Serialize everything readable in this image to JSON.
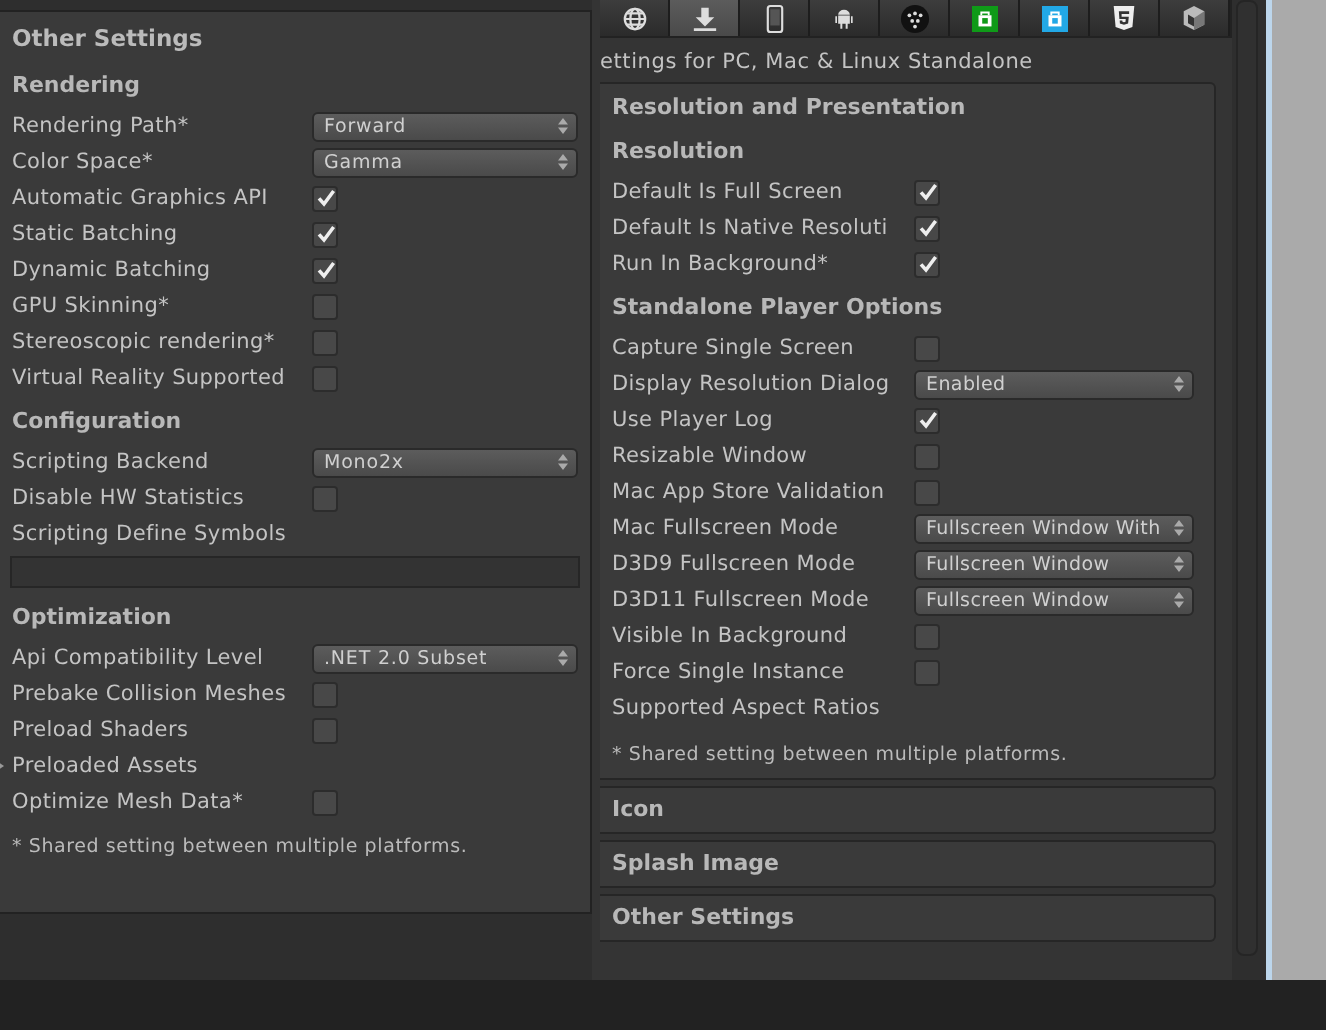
{
  "left_panel": {
    "title": "Other Settings",
    "sections": [
      {
        "heading": "Rendering",
        "rows": [
          {
            "kind": "dropdown",
            "label": "Rendering Path*",
            "value": "Forward"
          },
          {
            "kind": "dropdown",
            "label": "Color Space*",
            "value": "Gamma"
          },
          {
            "kind": "checkbox",
            "label": "Automatic Graphics API",
            "checked": true
          },
          {
            "kind": "checkbox",
            "label": "Static Batching",
            "checked": true
          },
          {
            "kind": "checkbox",
            "label": "Dynamic Batching",
            "checked": true
          },
          {
            "kind": "checkbox",
            "label": "GPU Skinning*",
            "checked": false
          },
          {
            "kind": "checkbox",
            "label": "Stereoscopic rendering*",
            "checked": false
          },
          {
            "kind": "checkbox",
            "label": "Virtual Reality Supported",
            "checked": false
          }
        ]
      },
      {
        "heading": "Configuration",
        "rows": [
          {
            "kind": "dropdown",
            "label": "Scripting Backend",
            "value": "Mono2x"
          },
          {
            "kind": "checkbox",
            "label": "Disable HW Statistics",
            "checked": false
          },
          {
            "kind": "label",
            "label": "Scripting Define Symbols"
          },
          {
            "kind": "textfield"
          }
        ]
      },
      {
        "heading": "Optimization",
        "rows": [
          {
            "kind": "dropdown",
            "label": "Api Compatibility Level",
            "value": ".NET 2.0 Subset"
          },
          {
            "kind": "checkbox",
            "label": "Prebake Collision Meshes",
            "checked": false
          },
          {
            "kind": "checkbox",
            "label": "Preload Shaders",
            "checked": false
          },
          {
            "kind": "foldout",
            "label": "Preloaded Assets",
            "expanded": false
          },
          {
            "kind": "checkbox",
            "label": "Optimize Mesh Data*",
            "checked": false
          }
        ]
      }
    ],
    "footnote": "* Shared setting between multiple platforms."
  },
  "right_panel": {
    "platform_tabs": [
      {
        "kind": "globe",
        "selected": false
      },
      {
        "kind": "download",
        "selected": true
      },
      {
        "kind": "phone",
        "selected": false
      },
      {
        "kind": "android",
        "selected": false
      },
      {
        "kind": "blackberry",
        "selected": false
      },
      {
        "kind": "store-green",
        "selected": false
      },
      {
        "kind": "store-blue",
        "selected": false
      },
      {
        "kind": "html5",
        "selected": false
      },
      {
        "kind": "cube",
        "selected": false
      }
    ],
    "subtitle": "ettings for PC, Mac & Linux Standalone",
    "section": {
      "title": "Resolution and Presentation",
      "groups": [
        {
          "heading": "Resolution",
          "rows": [
            {
              "kind": "checkbox",
              "label": "Default Is Full Screen",
              "checked": true
            },
            {
              "kind": "checkbox",
              "label": "Default Is Native Resoluti",
              "checked": true
            },
            {
              "kind": "checkbox",
              "label": "Run In Background*",
              "checked": true
            }
          ]
        },
        {
          "heading": "Standalone Player Options",
          "rows": [
            {
              "kind": "checkbox",
              "label": "Capture Single Screen",
              "checked": false
            },
            {
              "kind": "dropdown",
              "label": "Display Resolution Dialog",
              "value": "Enabled"
            },
            {
              "kind": "checkbox",
              "label": "Use Player Log",
              "checked": true
            },
            {
              "kind": "checkbox",
              "label": "Resizable Window",
              "checked": false
            },
            {
              "kind": "checkbox",
              "label": "Mac App Store Validation",
              "checked": false
            },
            {
              "kind": "dropdown",
              "label": "Mac Fullscreen Mode",
              "value": "Fullscreen Window With"
            },
            {
              "kind": "dropdown",
              "label": "D3D9 Fullscreen Mode",
              "value": "Fullscreen Window"
            },
            {
              "kind": "dropdown",
              "label": "D3D11 Fullscreen Mode",
              "value": "Fullscreen Window"
            },
            {
              "kind": "checkbox",
              "label": "Visible In Background",
              "checked": false
            },
            {
              "kind": "checkbox",
              "label": "Force Single Instance",
              "checked": false
            },
            {
              "kind": "label",
              "label": "Supported Aspect Ratios"
            }
          ]
        }
      ],
      "footnote": "* Shared setting between multiple platforms."
    },
    "collapsed_sections": [
      "Icon",
      "Splash Image",
      "Other Settings"
    ]
  }
}
